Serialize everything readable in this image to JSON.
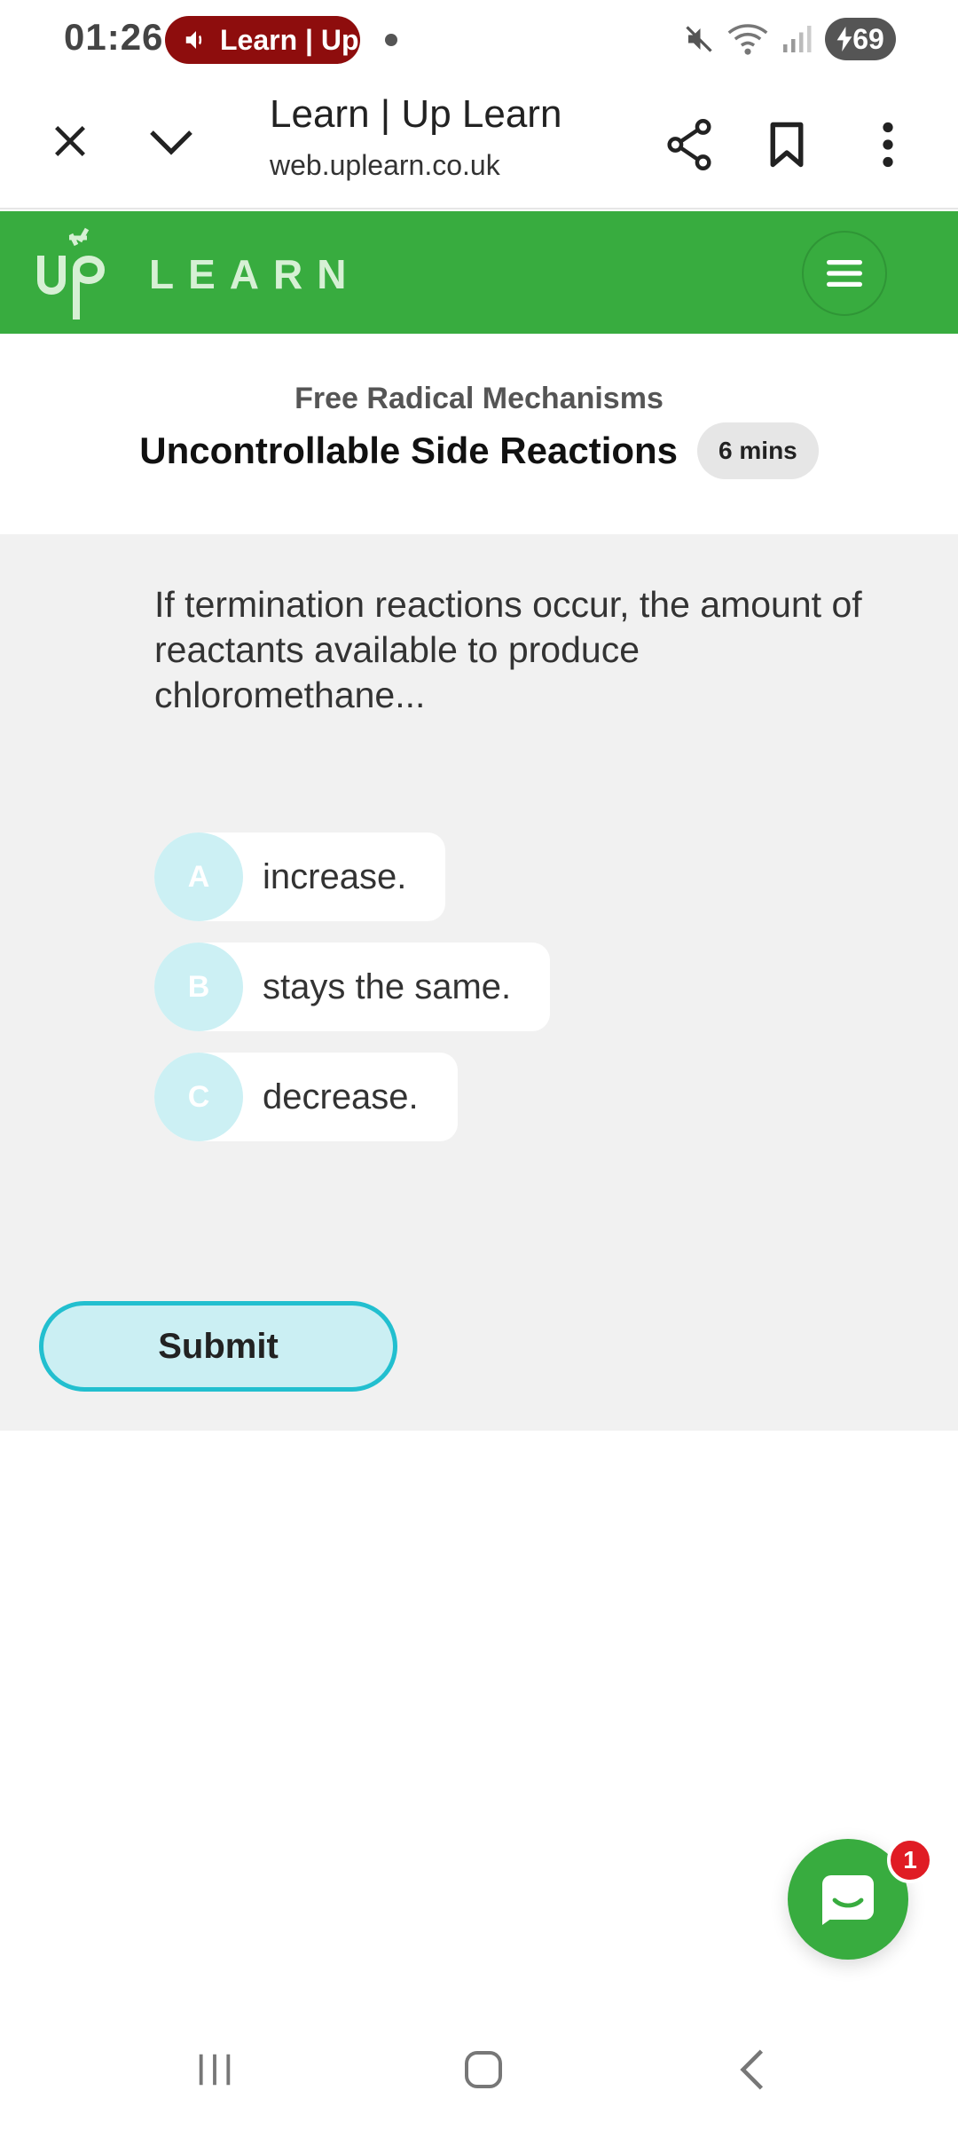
{
  "status_bar": {
    "time": "01:26",
    "media_label": "Learn | Up",
    "battery": "69"
  },
  "browser": {
    "title": "Learn | Up Learn",
    "url": "web.uplearn.co.uk"
  },
  "site": {
    "logo_text": "LEARN",
    "brand_color": "#38ac3f"
  },
  "lesson": {
    "topic": "Free Radical Mechanisms",
    "title": "Uncontrollable Side Reactions",
    "duration": "6 mins"
  },
  "question": {
    "text": "If termination reactions occur, the amount of reactants available to produce chloromethane...",
    "options": [
      {
        "letter": "A",
        "text": "increase."
      },
      {
        "letter": "B",
        "text": "stays the same."
      },
      {
        "letter": "C",
        "text": "decrease."
      }
    ],
    "submit_label": "Submit"
  },
  "chat": {
    "badge_count": "1"
  },
  "icons": {
    "close": "close-icon",
    "collapse": "chevron-down-icon",
    "share": "share-icon",
    "bookmark": "bookmark-icon",
    "more": "more-vert-icon",
    "menu": "hamburger-menu-icon",
    "chat": "chat-icon",
    "nav_recents": "recents-icon",
    "nav_home": "home-icon",
    "nav_back": "back-icon"
  }
}
